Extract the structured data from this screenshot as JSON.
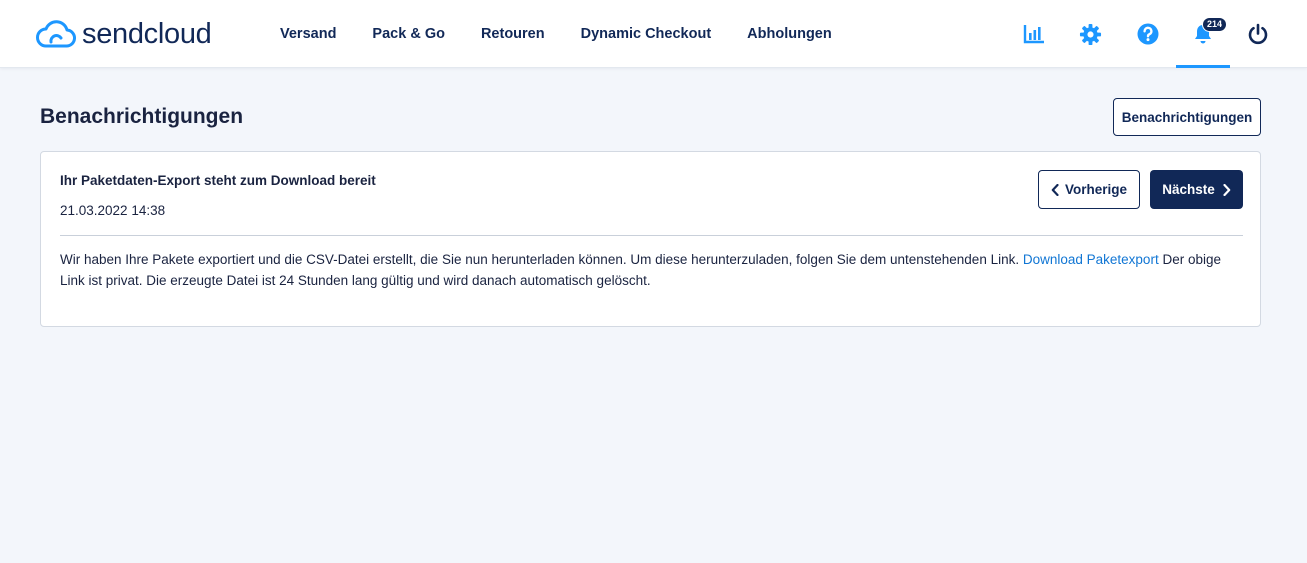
{
  "brand": {
    "name": "sendcloud"
  },
  "nav": {
    "items": [
      {
        "label": "Versand"
      },
      {
        "label": "Pack & Go"
      },
      {
        "label": "Retouren"
      },
      {
        "label": "Dynamic Checkout"
      },
      {
        "label": "Abholungen"
      }
    ]
  },
  "header_icons": {
    "analytics": "bar-chart-icon",
    "settings": "gear-icon",
    "help": "question-circle-icon",
    "notifications": "bell-icon",
    "notifications_badge": "214",
    "logout": "power-icon"
  },
  "page": {
    "title": "Benachrichtigungen",
    "action_button": "Benachrichtigungen"
  },
  "notification": {
    "title": "Ihr Paketdaten-Export steht zum Download bereit",
    "date": "21.03.2022 14:38",
    "prev_label": "Vorherige",
    "next_label": "Nächste",
    "body_before": "Wir haben Ihre Pakete exportiert und die CSV-Datei erstellt, die Sie nun herunterladen können. Um diese herunterzuladen, folgen Sie dem untenstehenden Link. ",
    "link_text": "Download Paketexport",
    "body_after": " Der obige Link ist privat. Die erzeugte Datei ist 24 Stunden lang gültig und wird danach automatisch gelöscht."
  },
  "colors": {
    "brand_navy": "#112857",
    "accent_blue": "#1d97ff",
    "link_blue": "#1176d4",
    "page_bg": "#f3f6fb"
  }
}
